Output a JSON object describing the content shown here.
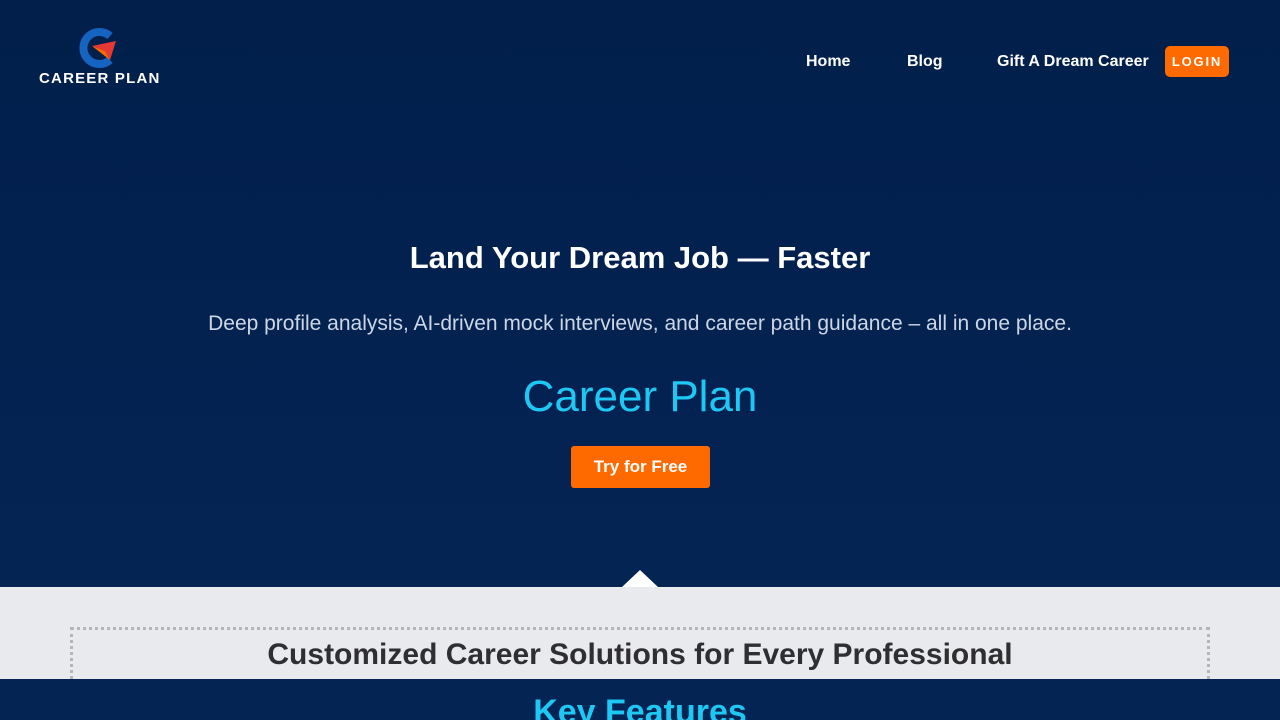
{
  "brand": {
    "logo_text": "CAREER PLAN",
    "logo_icon": "career-plan-g-arrow-logo",
    "colors": {
      "navy": "#03204d",
      "accent_orange": "#ff6a00",
      "accent_cyan": "#1ec8f5",
      "logo_blue": "#1565c0",
      "logo_red": "#e53935"
    }
  },
  "nav": {
    "items": [
      {
        "label": "Home"
      },
      {
        "label": "Blog"
      },
      {
        "label": "Gift A Dream Career"
      }
    ],
    "login_label": "LOGIN"
  },
  "hero": {
    "title": "Land Your Dream Job — Faster",
    "subtitle": "Deep profile analysis, AI-driven mock interviews, and career path guidance – all in one place.",
    "brand_name": "Career Plan",
    "cta_label": "Try for Free"
  },
  "solutions": {
    "title": "Customized Career Solutions for Every Professional"
  },
  "features": {
    "title": "Key Features"
  }
}
